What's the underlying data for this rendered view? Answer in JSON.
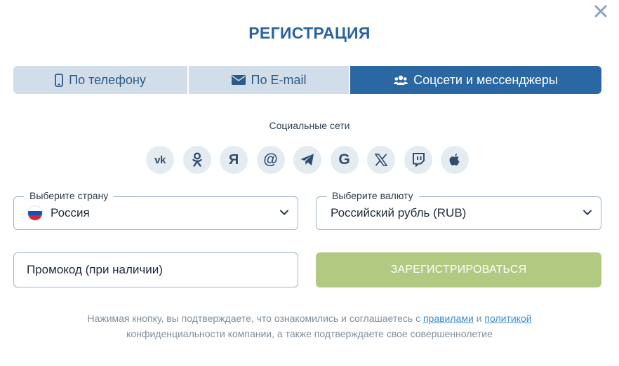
{
  "title": "РЕГИСТРАЦИЯ",
  "tabs": [
    {
      "label": "По телефону",
      "icon": "phone-icon"
    },
    {
      "label": "По E-mail",
      "icon": "mail-icon"
    },
    {
      "label": "Соцсети и мессенджеры",
      "icon": "users-icon",
      "active": true
    }
  ],
  "social": {
    "label": "Социальные сети",
    "networks": [
      {
        "name": "vk",
        "glyph": "vk"
      },
      {
        "name": "odnoklassniki",
        "glyph": ""
      },
      {
        "name": "yandex",
        "glyph": "Я"
      },
      {
        "name": "mail",
        "glyph": "@"
      },
      {
        "name": "telegram",
        "glyph": ""
      },
      {
        "name": "google",
        "glyph": "G"
      },
      {
        "name": "x",
        "glyph": "𝕏"
      },
      {
        "name": "twitch",
        "glyph": ""
      },
      {
        "name": "apple",
        "glyph": ""
      }
    ]
  },
  "country": {
    "legend": "Выберите страну",
    "value": "Россия"
  },
  "currency": {
    "legend": "Выберите валюту",
    "value": "Российский рубль (RUB)"
  },
  "promo": {
    "placeholder": "Промокод (при наличии)"
  },
  "register_label": "ЗАРЕГИСТРИРОВАТЬСЯ",
  "consent": {
    "text1": "Нажимая кнопку, вы подтверждаете, что ознакомились и соглашаетесь с ",
    "link1": "правилами",
    "text2": " и ",
    "link2": "политикой",
    "text3": "конфиденциальности компании, а также подтверждаете свое совершеннолетие"
  },
  "colors": {
    "accent": "#2a67a3",
    "tab_inactive": "#d1dde8",
    "register_disabled": "#b2c982",
    "link": "#3b8fd1"
  }
}
